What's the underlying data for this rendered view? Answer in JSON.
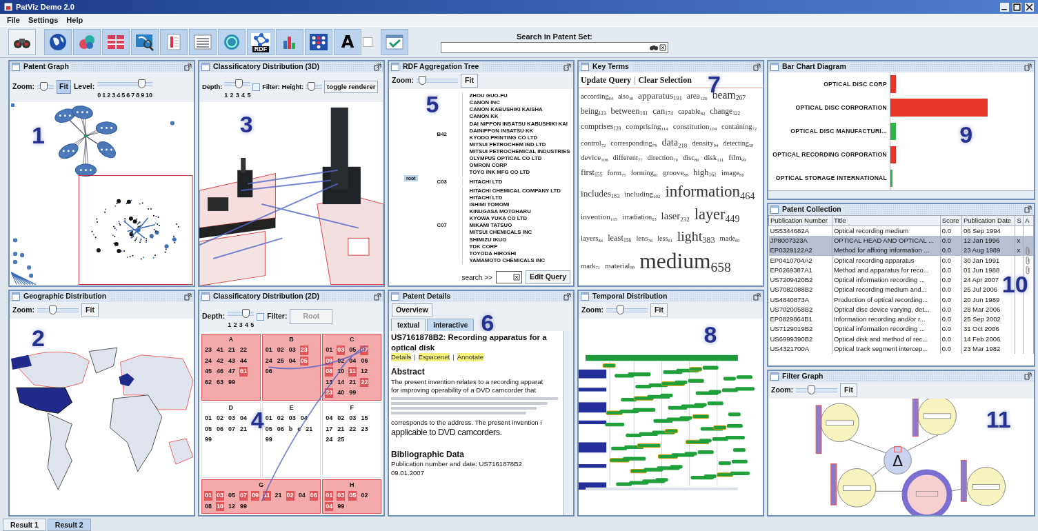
{
  "window": {
    "title": "PatViz Demo 2.0"
  },
  "menu": [
    {
      "label": "File"
    },
    {
      "label": "Settings"
    },
    {
      "label": "Help"
    }
  ],
  "toolbar": [
    {
      "kind": "binoculars"
    },
    {
      "kind": "globe"
    },
    {
      "kind": "blobs"
    },
    {
      "kind": "table_grid"
    },
    {
      "kind": "map_search"
    },
    {
      "kind": "document"
    },
    {
      "kind": "list_lines"
    },
    {
      "kind": "globe_teal"
    },
    {
      "kind": "network",
      "text": "RDF"
    },
    {
      "kind": "bar_chart"
    },
    {
      "kind": "dot_grid"
    },
    {
      "kind": "letter",
      "text": "A"
    },
    {
      "kind": "square"
    },
    {
      "kind": "check_window"
    }
  ],
  "search": {
    "label": "Search in Patent Set:"
  },
  "columns": [
    {
      "panels": [
        {
          "kind": "patent_graph",
          "title": "Patent Graph",
          "callout": "1",
          "controls": [
            {
              "kind": "label",
              "text": "Zoom:"
            },
            {
              "kind": "slider",
              "level": 0.3
            },
            {
              "kind": "button",
              "label": "Fit",
              "pressed": true,
              "disabled": false
            },
            {
              "kind": "label",
              "text": "Level:"
            },
            {
              "kind": "slider",
              "level": 0.85,
              "ticks": [
                "0",
                "1",
                "2",
                "3",
                "4",
                "5",
                "6",
                "7",
                "8",
                "9",
                "10"
              ]
            }
          ]
        },
        {
          "kind": "world_map",
          "title": "Geographic Distribution",
          "callout": "2",
          "controls": [
            {
              "kind": "label",
              "text": "Zoom:"
            },
            {
              "kind": "slider",
              "level": 0.35
            },
            {
              "kind": "button",
              "label": "Fit",
              "pressed": false,
              "disabled": false
            }
          ]
        }
      ]
    },
    {
      "panels": [
        {
          "kind": "class_3d",
          "title": "Classificatory Distribution (3D)",
          "callout": "3",
          "controls": [
            {
              "kind": "label",
              "text": "Depth:"
            },
            {
              "kind": "slider",
              "level": 0.6,
              "ticks": [
                "1",
                "2",
                "3",
                "4",
                "5"
              ]
            },
            {
              "kind": "checkbox",
              "label": "Filter:",
              "checked": false
            },
            {
              "kind": "label",
              "text": "Height:"
            },
            {
              "kind": "slider",
              "level": 0.2
            },
            {
              "kind": "button",
              "label": "toggle renderer",
              "pressed": false,
              "disabled": false
            }
          ]
        },
        {
          "kind": "class_2d",
          "title": "Classificatory Distribution (2D)",
          "callout": "4",
          "controls": [
            {
              "kind": "label",
              "text": "Depth:"
            },
            {
              "kind": "slider",
              "level": 0.75,
              "ticks": [
                "1",
                "2",
                "3",
                "4",
                "5"
              ]
            },
            {
              "kind": "checkbox",
              "label": "Filter:",
              "checked": false
            },
            {
              "kind": "button",
              "label": "Root",
              "pressed": false,
              "disabled": true
            }
          ],
          "sections": [
            {
              "label": "A",
              "highlighted": true,
              "cells": [
                {
                  "code": "23",
                  "hit": false
                },
                {
                  "code": "41",
                  "hit": false
                },
                {
                  "code": "21",
                  "hit": false
                },
                {
                  "code": "22",
                  "hit": false
                },
                {
                  "code": "24",
                  "hit": false
                },
                {
                  "code": "42",
                  "hit": false
                },
                {
                  "code": "43",
                  "hit": false
                },
                {
                  "code": "44",
                  "hit": false
                },
                {
                  "code": "45",
                  "hit": false
                },
                {
                  "code": "46",
                  "hit": false
                },
                {
                  "code": "47",
                  "hit": false
                },
                {
                  "code": "61",
                  "hit": true
                },
                {
                  "code": "62",
                  "hit": false
                },
                {
                  "code": "63",
                  "hit": false
                },
                {
                  "code": "99",
                  "hit": false
                }
              ]
            },
            {
              "label": "B",
              "highlighted": true,
              "cells": [
                {
                  "code": "01",
                  "hit": false
                },
                {
                  "code": "02",
                  "hit": false
                },
                {
                  "code": "03",
                  "hit": false
                },
                {
                  "code": "23",
                  "hit": true
                },
                {
                  "code": "24",
                  "hit": false
                },
                {
                  "code": "25",
                  "hit": false
                },
                {
                  "code": "04",
                  "hit": false
                },
                {
                  "code": "05",
                  "hit": true
                },
                {
                  "code": "06",
                  "hit": false
                }
              ]
            },
            {
              "label": "C",
              "highlighted": true,
              "cells": [
                {
                  "code": "01",
                  "hit": false
                },
                {
                  "code": "03",
                  "hit": true
                },
                {
                  "code": "05",
                  "hit": false
                },
                {
                  "code": "07",
                  "hit": true
                },
                {
                  "code": "09",
                  "hit": true
                },
                {
                  "code": "02",
                  "hit": false
                },
                {
                  "code": "04",
                  "hit": false
                },
                {
                  "code": "06",
                  "hit": false
                },
                {
                  "code": "08",
                  "hit": true
                },
                {
                  "code": "10",
                  "hit": false
                },
                {
                  "code": "11",
                  "hit": true
                },
                {
                  "code": "12",
                  "hit": false
                },
                {
                  "code": "13",
                  "hit": false
                },
                {
                  "code": "14",
                  "hit": false
                },
                {
                  "code": "21",
                  "hit": false
                },
                {
                  "code": "22",
                  "hit": true
                },
                {
                  "code": "23",
                  "hit": true
                },
                {
                  "code": "40",
                  "hit": false
                },
                {
                  "code": "99",
                  "hit": false
                }
              ]
            },
            {
              "label": "D",
              "highlighted": false,
              "cells": [
                {
                  "code": "01",
                  "hit": false
                },
                {
                  "code": "02",
                  "hit": false
                },
                {
                  "code": "03",
                  "hit": false
                },
                {
                  "code": "04",
                  "hit": false
                },
                {
                  "code": "05",
                  "hit": false
                },
                {
                  "code": "06",
                  "hit": false
                },
                {
                  "code": "07",
                  "hit": false
                },
                {
                  "code": "21",
                  "hit": false
                },
                {
                  "code": "99",
                  "hit": false
                }
              ]
            },
            {
              "label": "E",
              "highlighted": false,
              "cells": [
                {
                  "code": "01",
                  "hit": false
                },
                {
                  "code": "02",
                  "hit": false
                },
                {
                  "code": "03",
                  "hit": false
                },
                {
                  "code": "04",
                  "hit": false
                },
                {
                  "code": "05",
                  "hit": false
                },
                {
                  "code": "06",
                  "hit": false
                },
                {
                  "code": "b",
                  "hit": false
                },
                {
                  "code": "c",
                  "hit": false
                },
                {
                  "code": "21",
                  "hit": false
                },
                {
                  "code": "99",
                  "hit": false
                }
              ]
            },
            {
              "label": "F",
              "highlighted": false,
              "cells": [
                {
                  "code": "04",
                  "hit": false
                },
                {
                  "code": "02",
                  "hit": false
                },
                {
                  "code": "03",
                  "hit": false
                },
                {
                  "code": "15",
                  "hit": false
                },
                {
                  "code": "17",
                  "hit": false
                },
                {
                  "code": "21",
                  "hit": false
                },
                {
                  "code": "22",
                  "hit": false
                },
                {
                  "code": "23",
                  "hit": false
                },
                {
                  "code": "24",
                  "hit": false
                },
                {
                  "code": "25",
                  "hit": false
                }
              ]
            },
            {
              "label": "G",
              "highlighted": true,
              "cells": [
                {
                  "code": "01",
                  "hit": true
                },
                {
                  "code": "03",
                  "hit": true
                },
                {
                  "code": "05",
                  "hit": false
                },
                {
                  "code": "07",
                  "hit": true
                },
                {
                  "code": "09",
                  "hit": true
                },
                {
                  "code": "11",
                  "hit": true
                },
                {
                  "code": "21",
                  "hit": false
                },
                {
                  "code": "02",
                  "hit": true
                },
                {
                  "code": "04",
                  "hit": false
                },
                {
                  "code": "06",
                  "hit": true
                },
                {
                  "code": "08",
                  "hit": false
                },
                {
                  "code": "10",
                  "hit": true
                },
                {
                  "code": "12",
                  "hit": false
                },
                {
                  "code": "99",
                  "hit": false
                }
              ]
            },
            {
              "label": "H",
              "highlighted": true,
              "cells": [
                {
                  "code": "01",
                  "hit": true
                },
                {
                  "code": "03",
                  "hit": true
                },
                {
                  "code": "05",
                  "hit": true
                },
                {
                  "code": "02",
                  "hit": false
                },
                {
                  "code": "04",
                  "hit": true
                },
                {
                  "code": "99",
                  "hit": false
                }
              ]
            }
          ]
        }
      ]
    },
    {
      "panels": [
        {
          "kind": "rdf_tree",
          "title": "RDF Aggregation Tree",
          "callout": "5",
          "controls": [
            {
              "kind": "label",
              "text": "Zoom:"
            },
            {
              "kind": "slider",
              "level": 0.05
            },
            {
              "kind": "button",
              "label": "Fit",
              "pressed": false,
              "disabled": false
            }
          ],
          "tree": {
            "label": "root",
            "children": [
              {
                "label": "B42",
                "children": [
                  {
                    "label": "ZHOU GUO-FU"
                  },
                  {
                    "label": "CANON INC"
                  },
                  {
                    "label": "CANON KABUSHIKI KAISHA"
                  },
                  {
                    "label": "CANON KK"
                  },
                  {
                    "label": "DAI NIPPON INSATSU KABUSHIKI KAI"
                  },
                  {
                    "label": "DAINIPPON INSATSU KK"
                  },
                  {
                    "label": "KYODO PRINTING CO LTD"
                  },
                  {
                    "label": "MITSUI PETROCHEM IND LTD"
                  },
                  {
                    "label": "MITSUI PETROCHEMICAL INDUSTRIES"
                  },
                  {
                    "label": "OLYMPUS OPTICAL CO LTD"
                  },
                  {
                    "label": "OMRON CORP"
                  },
                  {
                    "label": "TOYO INK MFG CO LTD"
                  }
                ]
              },
              {
                "label": "C03",
                "children": [
                  {
                    "label": "HITACHI LTD"
                  }
                ]
              },
              {
                "label": "C07",
                "children": [
                  {
                    "label": "HITACHI CHEMICAL COMPANY LTD"
                  },
                  {
                    "label": "HITACHI LTD"
                  },
                  {
                    "label": "ISHIMI TOMOMI"
                  },
                  {
                    "label": "KINUGASA MOTOHARU"
                  },
                  {
                    "label": "KYOWA YUKA CO LTD"
                  },
                  {
                    "label": "MIKAMI TATSUO"
                  },
                  {
                    "label": "MITSUI CHEMICALS INC"
                  },
                  {
                    "label": "SHIMIZU IKUO"
                  },
                  {
                    "label": "TDK CORP"
                  },
                  {
                    "label": "TOYODA HIROSHI"
                  },
                  {
                    "label": "YAMAMOTO CHEMICALS INC"
                  }
                ]
              }
            ]
          },
          "footer": [
            {
              "kind": "label",
              "text": "search >>"
            },
            {
              "kind": "field"
            },
            {
              "kind": "button",
              "label": "Edit Query",
              "pressed": false,
              "disabled": false
            }
          ]
        },
        {
          "kind": "patent_details",
          "title": "Patent Details",
          "callout": "6",
          "controls": [
            {
              "kind": "button",
              "label": "Overview",
              "pressed": false,
              "disabled": false
            }
          ],
          "tabs": [
            {
              "label": "textual",
              "selected": false
            },
            {
              "label": "interactive",
              "selected": true
            }
          ],
          "blocks": [
            {
              "kind": "title",
              "text": "US7161878B2: Recording apparatus for a"
            },
            {
              "kind": "title",
              "text": "optical disk"
            },
            {
              "kind": "links",
              "items": [
                {
                  "kind": "link",
                  "text": "Details"
                },
                {
                  "kind": "sep",
                  "text": "|"
                },
                {
                  "kind": "link",
                  "text": "Espacenet"
                },
                {
                  "kind": "sep",
                  "text": "|"
                },
                {
                  "kind": "link",
                  "text": "Annotate"
                }
              ]
            },
            {
              "kind": "heading",
              "text": "Abstract"
            },
            {
              "kind": "line",
              "text": "The present invention relates to a recording apparat"
            },
            {
              "kind": "line",
              "text": "for improving operability of a DVD camcorder that"
            },
            {
              "kind": "blur"
            },
            {
              "kind": "line",
              "text": "corresponds to the address. The present invention i"
            },
            {
              "kind": "large",
              "text": "applicable to DVD camcorders."
            },
            {
              "kind": "heading",
              "text": "Bibliographic Data"
            },
            {
              "kind": "line",
              "text": "Publication number and date: US7161878B2"
            },
            {
              "kind": "line",
              "text": "09.01.2007"
            }
          ]
        }
      ]
    },
    {
      "panels": [
        {
          "kind": "key_terms",
          "title": "Key Terms",
          "callout": "7",
          "actions": [
            {
              "kind": "link",
              "text": "Update Query"
            },
            {
              "kind": "sep",
              "text": "|"
            },
            {
              "kind": "link",
              "text": "Clear Selection"
            }
          ],
          "terms": [
            {
              "term": "according",
              "count": "64"
            },
            {
              "term": "also",
              "count": "38"
            },
            {
              "term": "apparatus",
              "count": "191"
            },
            {
              "term": "area",
              "count": "120"
            },
            {
              "term": "beam",
              "count": "267"
            },
            {
              "term": "being",
              "count": "123"
            },
            {
              "term": "between",
              "count": "161"
            },
            {
              "term": "can",
              "count": "174"
            },
            {
              "term": "capable",
              "count": "82"
            },
            {
              "term": "change",
              "count": "122"
            },
            {
              "term": "comprises",
              "count": "129"
            },
            {
              "term": "comprising",
              "count": "114"
            },
            {
              "term": "constitution",
              "count": "104"
            },
            {
              "term": "containing",
              "count": "72"
            },
            {
              "term": "control",
              "count": "72"
            },
            {
              "term": "corresponding",
              "count": "78"
            },
            {
              "term": "data",
              "count": "218"
            },
            {
              "term": "density",
              "count": "94"
            },
            {
              "term": "detecting",
              "count": "58"
            },
            {
              "term": "device",
              "count": "106"
            },
            {
              "term": "different",
              "count": "77"
            },
            {
              "term": "direction",
              "count": "79"
            },
            {
              "term": "disc",
              "count": "80"
            },
            {
              "term": "disk",
              "count": "111"
            },
            {
              "term": "film",
              "count": "99"
            },
            {
              "term": "first",
              "count": "155"
            },
            {
              "term": "form",
              "count": "75"
            },
            {
              "term": "forming",
              "count": "61"
            },
            {
              "term": "groove",
              "count": "88"
            },
            {
              "term": "high",
              "count": "161"
            },
            {
              "term": "image",
              "count": "80"
            },
            {
              "term": "includes",
              "count": "183"
            },
            {
              "term": "including",
              "count": "102"
            },
            {
              "term": "information",
              "count": "464"
            },
            {
              "term": "invention",
              "count": "115"
            },
            {
              "term": "irradiation",
              "count": "63"
            },
            {
              "term": "laser",
              "count": "232"
            },
            {
              "term": "layer",
              "count": "449"
            },
            {
              "term": "layers",
              "count": "84"
            },
            {
              "term": "least",
              "count": "156"
            },
            {
              "term": "lens",
              "count": "76"
            },
            {
              "term": "less",
              "count": "61"
            },
            {
              "term": "light",
              "count": "383"
            },
            {
              "term": "made",
              "count": "69"
            },
            {
              "term": "mark",
              "count": "71"
            },
            {
              "term": "material",
              "count": "99"
            },
            {
              "term": "medium",
              "count": "658"
            }
          ]
        },
        {
          "kind": "timeline",
          "title": "Temporal Distribution",
          "callout": "8",
          "controls": [
            {
              "kind": "label",
              "text": "Zoom:"
            },
            {
              "kind": "slider",
              "level": 0.3
            },
            {
              "kind": "button",
              "label": "Fit",
              "pressed": false,
              "disabled": false
            }
          ]
        }
      ]
    },
    {
      "panels": [
        {
          "kind": "bar_chart",
          "title": "Bar Chart Diagram",
          "callout": "9",
          "bars": [
            {
              "label": "OPTICAL DISC CORP",
              "level": 0.04,
              "color": "#e8352b"
            },
            {
              "label": "OPTICAL DISC CORPORATION",
              "level": 0.72,
              "color": "#e8352b"
            },
            {
              "label": "OPTICAL DISC MANUFACTURI...",
              "level": 0.04,
              "color": "#2fb34a"
            },
            {
              "label": "OPTICAL RECORDING CORPORATION",
              "level": 0.04,
              "color": "#e8352b"
            },
            {
              "label": "OPTICAL STORAGE INTERNATIONAL",
              "level": 0.015,
              "color": "#2fb34a"
            }
          ]
        },
        {
          "kind": "table",
          "title": "Patent Collection",
          "callout": "10",
          "columns": [
            "Publication Number",
            "Title",
            "Score",
            "Publication Date",
            "S",
            "A"
          ],
          "rows": [
            {
              "number": "US5344682A",
              "title": "Optical recording medium",
              "score": "0.0",
              "date": "06 Sep 1994",
              "selected": false,
              "attached": false
            },
            {
              "number": "JP8007323A",
              "title": "OPTICAL HEAD AND OPTICAL ...",
              "score": "0.0",
              "date": "12 Jan 1996",
              "s": "x",
              "selected": true,
              "attached": false
            },
            {
              "number": "EP0329122A2",
              "title": "Method for affixing information ...",
              "score": "0.0",
              "date": "23 Aug 1989",
              "s": "x",
              "selected": true,
              "attached": true
            },
            {
              "number": "EP0410704A2",
              "title": "Optical recording apparatus",
              "score": "0.0",
              "date": "30 Jan 1991",
              "selected": false,
              "attached": true
            },
            {
              "number": "EP0269387A1",
              "title": "Method and apparatus for reco...",
              "score": "0.0",
              "date": "01 Jun 1988",
              "selected": false,
              "attached": true
            },
            {
              "number": "US7209420B2",
              "title": "Optical information recording ...",
              "score": "0.0",
              "date": "24 Apr 2007",
              "selected": false,
              "attached": false
            },
            {
              "number": "US7082088B2",
              "title": "Optical recording medium and...",
              "score": "0.0",
              "date": "25 Jul 2006",
              "selected": false,
              "attached": false
            },
            {
              "number": "US4840873A",
              "title": "Production of optical recording...",
              "score": "0.0",
              "date": "20 Jun 1989",
              "selected": false,
              "attached": false
            },
            {
              "number": "US7020058B2",
              "title": "Optical disc device varying, det...",
              "score": "0.0",
              "date": "28 Mar 2006",
              "selected": false,
              "attached": false
            },
            {
              "number": "EP0829864B1",
              "title": "Information recording and/or r...",
              "score": "0.0",
              "date": "25 Sep 2002",
              "selected": false,
              "attached": false
            },
            {
              "number": "US7129019B2",
              "title": "Optical information recording ...",
              "score": "0.0",
              "date": "31 Oct 2006",
              "selected": false,
              "attached": false
            },
            {
              "number": "US6999390B2",
              "title": "Optical disk and method of rec...",
              "score": "0.0",
              "date": "14 Feb 2006",
              "selected": false,
              "attached": false
            },
            {
              "number": "US4321700A",
              "title": "Optical track segment intercep...",
              "score": "0.0",
              "date": "23 Mar 1982",
              "selected": false,
              "attached": false
            }
          ]
        },
        {
          "kind": "filter_graph",
          "title": "Filter Graph",
          "callout": "11",
          "controls": [
            {
              "kind": "label",
              "text": "Zoom:"
            },
            {
              "kind": "slider",
              "level": 0.35
            },
            {
              "kind": "button",
              "label": "Fit",
              "pressed": false,
              "disabled": false
            }
          ],
          "operator": "Δ"
        }
      ]
    }
  ],
  "result_tabs": [
    {
      "label": "Result 1",
      "selected": false
    },
    {
      "label": "Result 2",
      "selected": true
    }
  ]
}
